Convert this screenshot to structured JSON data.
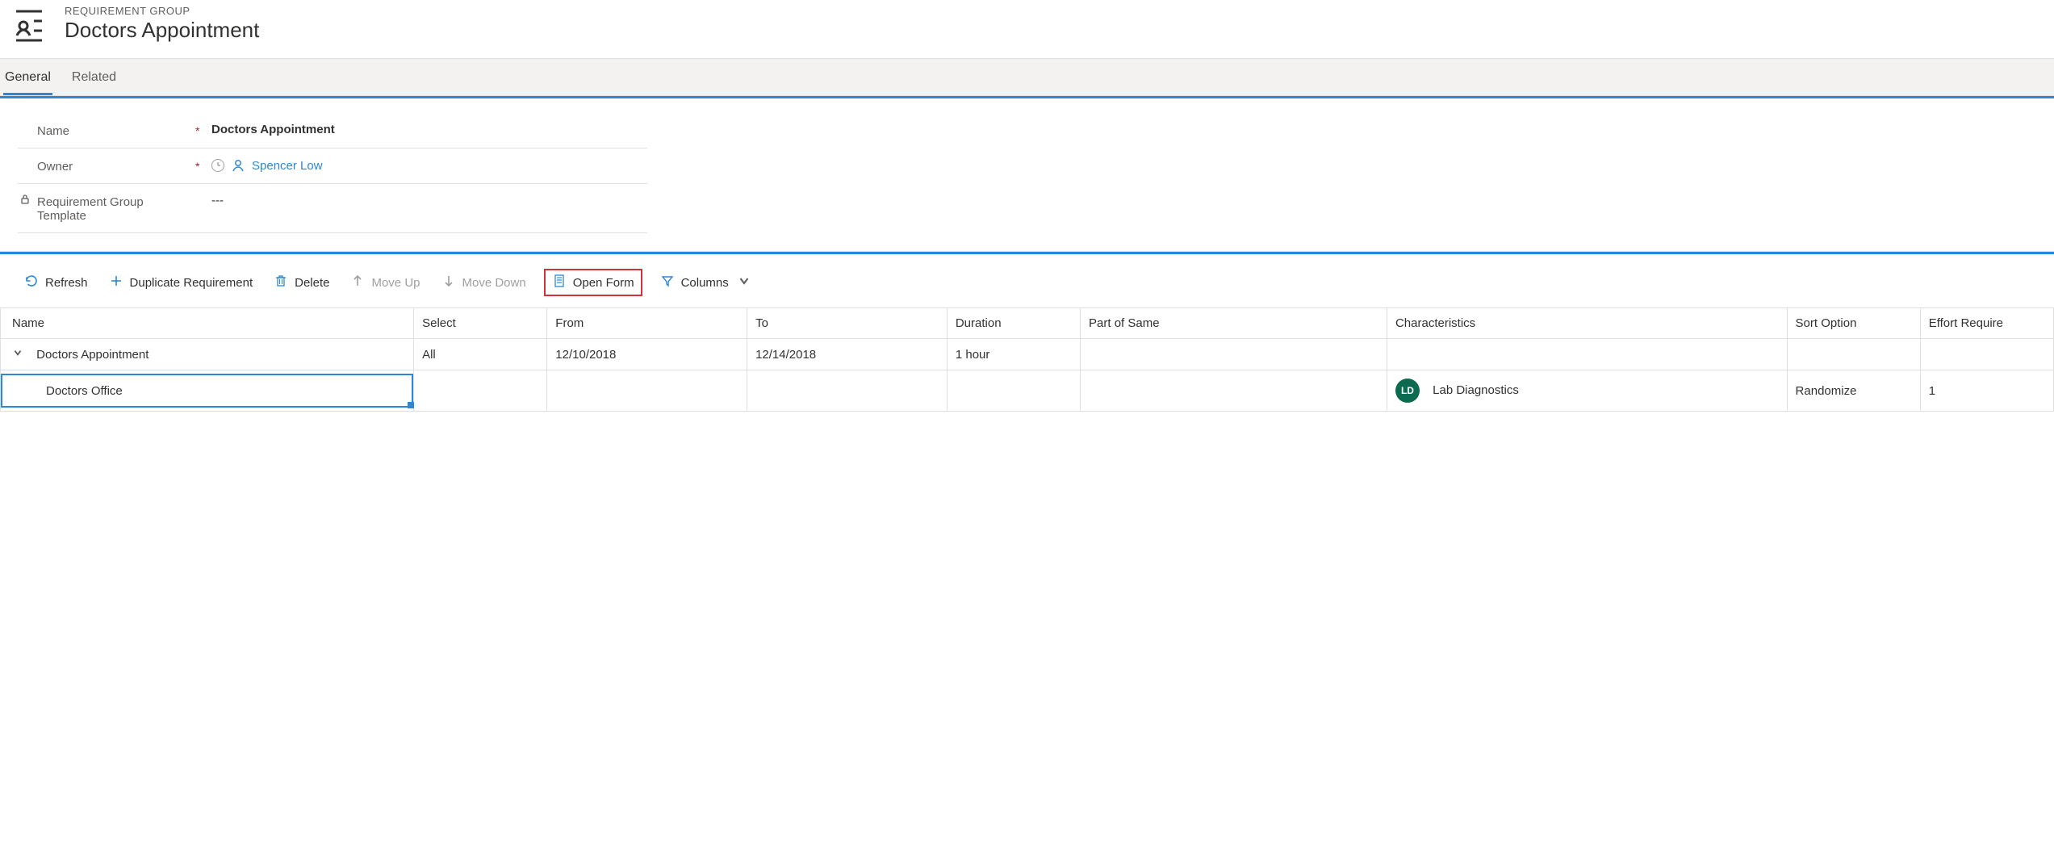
{
  "header": {
    "entity_type": "REQUIREMENT GROUP",
    "entity_name": "Doctors Appointment"
  },
  "tabs": [
    {
      "label": "General",
      "active": true
    },
    {
      "label": "Related",
      "active": false
    }
  ],
  "form": {
    "name": {
      "label": "Name",
      "required": "*",
      "value": "Doctors Appointment"
    },
    "owner": {
      "label": "Owner",
      "required": "*",
      "value": "Spencer Low"
    },
    "template": {
      "label": "Requirement Group Template",
      "required": "",
      "value": "---"
    }
  },
  "toolbar": {
    "refresh": "Refresh",
    "duplicate": "Duplicate Requirement",
    "delete": "Delete",
    "move_up": "Move Up",
    "move_down": "Move Down",
    "open_form": "Open Form",
    "columns": "Columns"
  },
  "grid": {
    "columns": [
      "Name",
      "Select",
      "From",
      "To",
      "Duration",
      "Part of Same",
      "Characteristics",
      "Sort Option",
      "Effort Require"
    ],
    "rows": [
      {
        "name": "Doctors Appointment",
        "select": "All",
        "from": "12/10/2018",
        "to": "12/14/2018",
        "duration": "1 hour",
        "part_of_same": "",
        "characteristics": "",
        "char_badge": "",
        "sort_option": "",
        "effort": "",
        "expandable": true,
        "selected": false
      },
      {
        "name": "Doctors Office",
        "select": "",
        "from": "",
        "to": "",
        "duration": "",
        "part_of_same": "",
        "characteristics": "Lab Diagnostics",
        "char_badge": "LD",
        "sort_option": "Randomize",
        "effort": "1",
        "expandable": false,
        "selected": true
      }
    ]
  }
}
